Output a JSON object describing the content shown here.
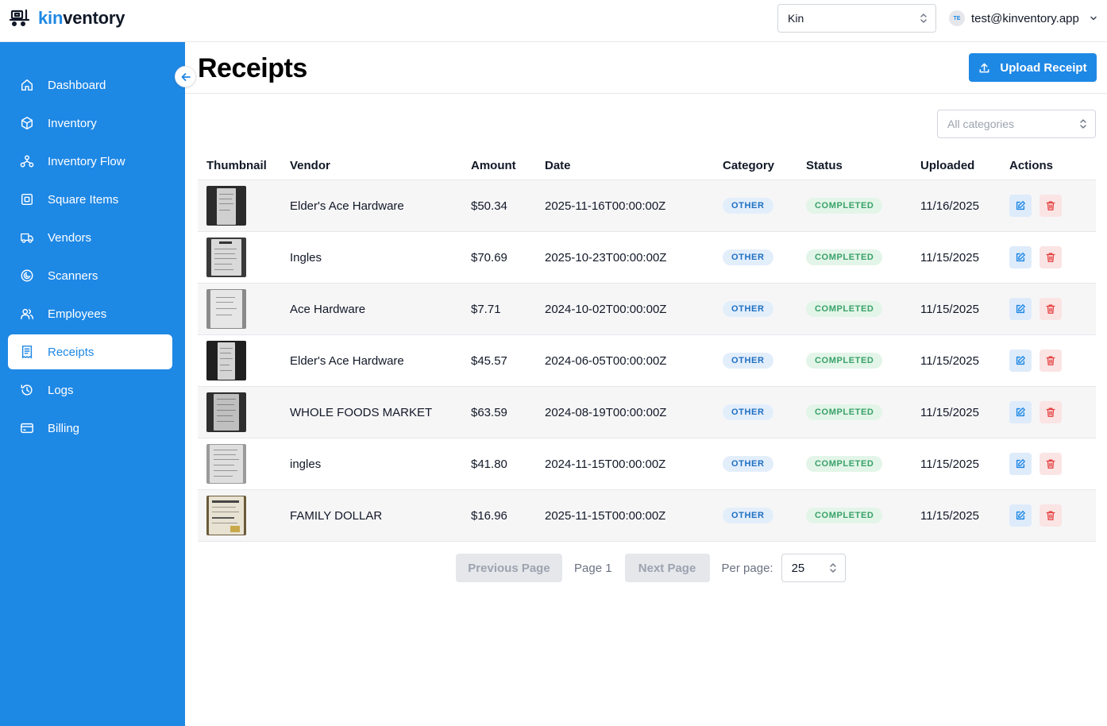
{
  "app": {
    "logo_part1": "kin",
    "logo_part2": "ventory"
  },
  "header": {
    "org_select_value": "Kin",
    "user_initials": "TE",
    "user_email": "test@kinventory.app"
  },
  "sidebar": {
    "items": [
      {
        "label": "Dashboard",
        "icon": "home-icon"
      },
      {
        "label": "Inventory",
        "icon": "box-icon"
      },
      {
        "label": "Inventory Flow",
        "icon": "flow-icon"
      },
      {
        "label": "Square Items",
        "icon": "square-icon"
      },
      {
        "label": "Vendors",
        "icon": "truck-icon"
      },
      {
        "label": "Scanners",
        "icon": "scanner-icon"
      },
      {
        "label": "Employees",
        "icon": "users-icon"
      },
      {
        "label": "Receipts",
        "icon": "receipt-icon",
        "active": true
      },
      {
        "label": "Logs",
        "icon": "history-icon"
      },
      {
        "label": "Billing",
        "icon": "credit-card-icon"
      }
    ]
  },
  "page": {
    "title": "Receipts",
    "upload_label": "Upload Receipt",
    "category_placeholder": "All categories"
  },
  "table": {
    "columns": [
      "Thumbnail",
      "Vendor",
      "Amount",
      "Date",
      "Category",
      "Status",
      "Uploaded",
      "Actions"
    ],
    "rows": [
      {
        "vendor": "Elder's Ace Hardware",
        "amount": "$50.34",
        "date": "2025-11-16T00:00:00Z",
        "category": "OTHER",
        "status": "COMPLETED",
        "uploaded": "11/16/2025"
      },
      {
        "vendor": "Ingles",
        "amount": "$70.69",
        "date": "2025-10-23T00:00:00Z",
        "category": "OTHER",
        "status": "COMPLETED",
        "uploaded": "11/15/2025"
      },
      {
        "vendor": "Ace Hardware",
        "amount": "$7.71",
        "date": "2024-10-02T00:00:00Z",
        "category": "OTHER",
        "status": "COMPLETED",
        "uploaded": "11/15/2025"
      },
      {
        "vendor": "Elder's Ace Hardware",
        "amount": "$45.57",
        "date": "2024-06-05T00:00:00Z",
        "category": "OTHER",
        "status": "COMPLETED",
        "uploaded": "11/15/2025"
      },
      {
        "vendor": "WHOLE FOODS MARKET",
        "amount": "$63.59",
        "date": "2024-08-19T00:00:00Z",
        "category": "OTHER",
        "status": "COMPLETED",
        "uploaded": "11/15/2025"
      },
      {
        "vendor": "ingles",
        "amount": "$41.80",
        "date": "2024-11-15T00:00:00Z",
        "category": "OTHER",
        "status": "COMPLETED",
        "uploaded": "11/15/2025"
      },
      {
        "vendor": "FAMILY DOLLAR",
        "amount": "$16.96",
        "date": "2025-11-15T00:00:00Z",
        "category": "OTHER",
        "status": "COMPLETED",
        "uploaded": "11/15/2025"
      }
    ]
  },
  "pagination": {
    "prev_label": "Previous Page",
    "page_label": "Page 1",
    "next_label": "Next Page",
    "per_page_label": "Per page:",
    "per_page_value": "25"
  },
  "colors": {
    "brand": "#1e88e5",
    "status_completed": "#38a169",
    "danger": "#e53e3e"
  }
}
